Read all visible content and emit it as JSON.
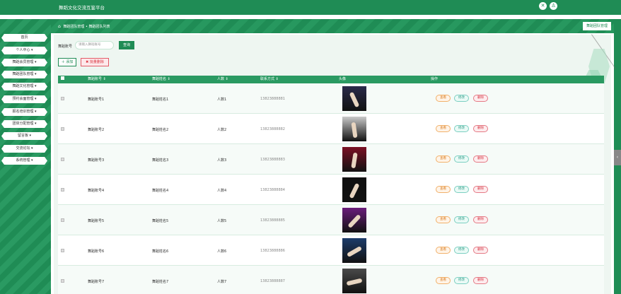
{
  "app": {
    "title": "舞蹈文化交流互鉴平台"
  },
  "topbar_icons": [
    {
      "name": "close-icon",
      "glyph": "✕"
    },
    {
      "name": "user-icon",
      "glyph": "♙"
    }
  ],
  "sidebar": {
    "items": [
      {
        "label": "首页"
      },
      {
        "label": "个人中心 ▾"
      },
      {
        "label": "舞蹈会员管理 ▾"
      },
      {
        "label": "舞蹈团队管理 ▾"
      },
      {
        "label": "舞蹈文化管理 ▾"
      },
      {
        "label": "预约会面管理 ▾"
      },
      {
        "label": "报名培训管理 ▾"
      },
      {
        "label": "团体分配管理 ▾"
      },
      {
        "label": "留言板 ▾"
      },
      {
        "label": "交流论坛 ▾"
      },
      {
        "label": "系统管理 ▾"
      }
    ]
  },
  "breadcrumb": {
    "home_icon": "⌂",
    "path": "舞蹈团队管理 • 舞蹈团队列表",
    "right_button": "舞蹈团队管理"
  },
  "search": {
    "label": "舞蹈账号",
    "placeholder": "请输入舞蹈账号",
    "button": "查询"
  },
  "actions": {
    "add": "＋ 添加",
    "batch_delete": "✖ 批量删除"
  },
  "table": {
    "headers": [
      "舞蹈账号 ⇕",
      "舞蹈姓名 ⇕",
      "人数 ⇕",
      "联系方式 ⇕",
      "头像",
      "操作"
    ],
    "rows": [
      {
        "account": "舞蹈账号1",
        "name": "舞蹈姓名1",
        "count": "人数1",
        "phone": "13823888881",
        "photo_tone": "#2a2a4a"
      },
      {
        "account": "舞蹈账号2",
        "name": "舞蹈姓名2",
        "count": "人数2",
        "phone": "13823888882",
        "photo_tone": "#c9c9c9"
      },
      {
        "account": "舞蹈账号3",
        "name": "舞蹈姓名3",
        "count": "人数3",
        "phone": "13823888883",
        "photo_tone": "#7a1024"
      },
      {
        "account": "舞蹈账号4",
        "name": "舞蹈姓名4",
        "count": "人数4",
        "phone": "13823888884",
        "photo_tone": "#101010"
      },
      {
        "account": "舞蹈账号5",
        "name": "舞蹈姓名5",
        "count": "人数5",
        "phone": "13823888885",
        "photo_tone": "#6a1c7a"
      },
      {
        "account": "舞蹈账号6",
        "name": "舞蹈姓名6",
        "count": "人数6",
        "phone": "13823888886",
        "photo_tone": "#1c3c6a"
      },
      {
        "account": "舞蹈账号7",
        "name": "舞蹈姓名7",
        "count": "人数7",
        "phone": "13823888887",
        "photo_tone": "#4a4a4a"
      }
    ],
    "row_actions": {
      "view": "查看",
      "edit": "修改",
      "delete": "删除"
    }
  },
  "colors": {
    "primary": "#1f8c55",
    "view": "#d97a1a",
    "edit": "#2a9a84",
    "delete": "#d6323f"
  }
}
